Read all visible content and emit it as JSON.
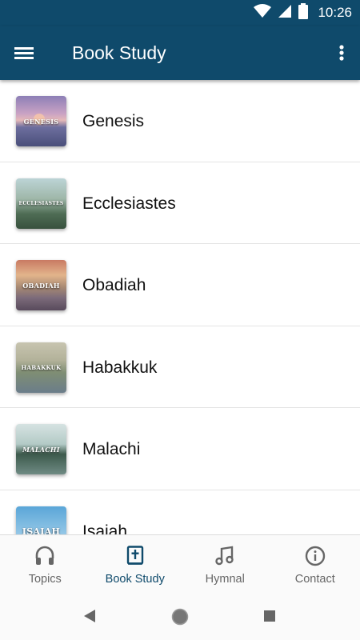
{
  "status_bar": {
    "time": "10:26",
    "icons": [
      "wifi-icon",
      "signal-icon",
      "battery-icon"
    ]
  },
  "app_bar": {
    "title": "Book Study",
    "menu_icon": "hamburger-menu-icon",
    "overflow_icon": "more-vertical-icon"
  },
  "books": [
    {
      "title": "Genesis",
      "thumb_text": "GENESIS",
      "thumb_style": "t-genesis"
    },
    {
      "title": "Ecclesiastes",
      "thumb_text": "ECCLESIASTES",
      "thumb_style": "t-eccl"
    },
    {
      "title": "Obadiah",
      "thumb_text": "OBADIAH",
      "thumb_style": "t-obad"
    },
    {
      "title": "Habakkuk",
      "thumb_text": "HABAKKUK",
      "thumb_style": "t-habak"
    },
    {
      "title": "Malachi",
      "thumb_text": "MALACHI",
      "thumb_style": "t-malachi"
    },
    {
      "title": "Isaiah",
      "thumb_text": "ISAIAH",
      "thumb_style": "t-isaiah"
    }
  ],
  "bottom_nav": {
    "items": [
      {
        "label": "Topics",
        "icon": "headphones-icon",
        "active": false
      },
      {
        "label": "Book Study",
        "icon": "bible-icon",
        "active": true
      },
      {
        "label": "Hymnal",
        "icon": "music-note-icon",
        "active": false
      },
      {
        "label": "Contact",
        "icon": "info-icon",
        "active": false
      }
    ]
  },
  "system_nav": {
    "icons": [
      "back-icon",
      "home-icon",
      "recents-icon"
    ]
  },
  "colors": {
    "primary": "#0f4a6b",
    "text": "#111111",
    "inactive": "#666666"
  }
}
